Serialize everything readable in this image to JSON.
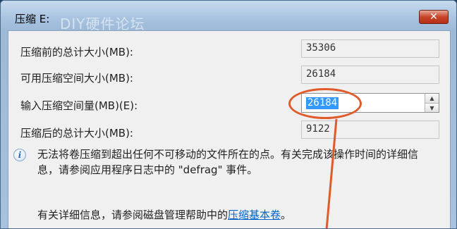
{
  "window": {
    "title": "压缩 E:",
    "watermark": "DIY硬件论坛",
    "close_glyph": "✕"
  },
  "form": {
    "total_before": {
      "label": "压缩前的总计大小(MB):",
      "value": "35306"
    },
    "available": {
      "label": "可用压缩空间大小(MB):",
      "value": "26184"
    },
    "input_amount": {
      "label": "输入压缩空间量(MB)(E):",
      "value": "26184",
      "up_glyph": "▲",
      "down_glyph": "▼"
    },
    "total_after": {
      "label": "压缩后的总计大小(MB):",
      "value": "9122"
    }
  },
  "info": {
    "icon": "info-icon",
    "message": "无法将卷压缩到超出任何不可移动的文件所在的点。有关完成该操作时间的详细信息，请参阅应用程序日志中的 \"defrag\" 事件。"
  },
  "help": {
    "prefix": "有关详细信息，请参阅磁盘管理帮助中的",
    "link_text": "压缩基本卷",
    "suffix": "。"
  },
  "colors": {
    "annotation": "#e05a2a",
    "selection": "#3399ff",
    "link": "#0066cc"
  }
}
